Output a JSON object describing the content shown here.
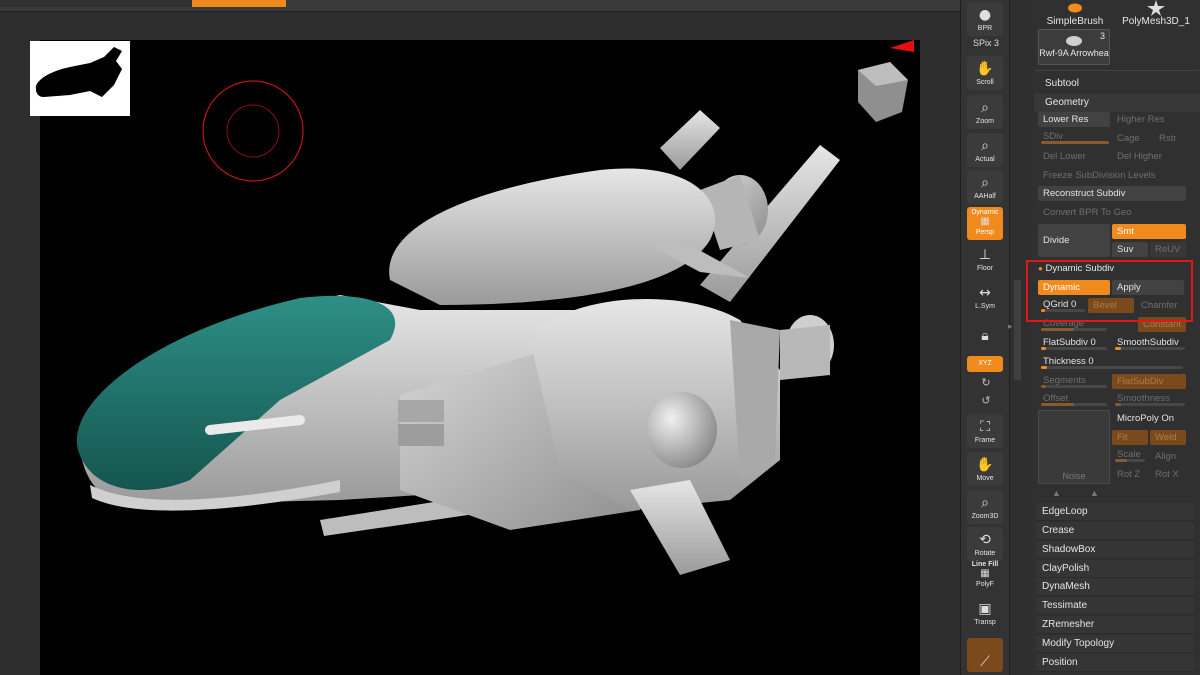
{
  "colors": {
    "accent": "#f08a1d",
    "highlight_box": "#e0161b",
    "hull": "#c9c9c9",
    "canopy": "#1f7a73",
    "viewport_bg": "#000000",
    "brush_circle": "#c0141a"
  },
  "shelf": {
    "bpr": "BPR",
    "spix": "SPix 3",
    "scroll": "Scroll",
    "zoom": "Zoom",
    "actual": "Actual",
    "aahalf": "AAHalf",
    "dynamic": "Dynamic",
    "persp": "Persp",
    "floor": "Floor",
    "lsym": "L.Sym",
    "xyz": "XYZ",
    "frame": "Frame",
    "move": "Move",
    "zoom3d": "Zoom3D",
    "rotate": "Rotate",
    "line_fill": "Line Fill",
    "polyf": "PolyF",
    "transp": "Transp"
  },
  "palette": {
    "tools": {
      "simplebrush": "SimpleBrush",
      "polymesh": "PolyMesh3D_1",
      "arrowhead": "Rwf-9A Arrowhea",
      "arrowhead_count": "3"
    },
    "subtool": "Subtool",
    "geometry": "Geometry",
    "lower_res": "Lower Res",
    "higher_res": "Higher Res",
    "sdiv": "SDiv",
    "cage": "Cage",
    "rstr": "Rstr",
    "del_lower": "Del Lower",
    "del_higher": "Del Higher",
    "freeze": "Freeze SubDivision Levels",
    "reconstruct": "Reconstruct Subdiv",
    "convert_bpr": "Convert BPR To Geo",
    "divide": "Divide",
    "smt": "Smt",
    "suv": "Suv",
    "reuv": "ReUV",
    "dynamic_subdiv": "Dynamic Subdiv",
    "dynamic": "Dynamic",
    "apply": "Apply",
    "qgrid": "QGrid 0",
    "qgrid_level": 0.08,
    "bevel": "Bevel",
    "chamfer": "Chamfer",
    "coverage": "Coverage",
    "constant": "Constant",
    "flatsubdiv": "FlatSubdiv 0",
    "smoothsubdiv": "SmoothSubdiv",
    "thickness": "Thickness 0",
    "segments": "Segments",
    "flatsubdiv_btn": "FlatSubDiv",
    "offset": "Offset",
    "smoothness": "Smoothness",
    "micropoly": "MicroPoly On",
    "fit": "Fit",
    "weld": "Weld",
    "scale": "Scale",
    "align": "Align",
    "rotz": "Rot Z",
    "rotx": "Rot X",
    "noise": "Noise",
    "menus": [
      "EdgeLoop",
      "Crease",
      "ShadowBox",
      "ClayPolish",
      "DynaMesh",
      "Tessimate",
      "ZRemesher",
      "Modify Topology",
      "Position"
    ]
  }
}
